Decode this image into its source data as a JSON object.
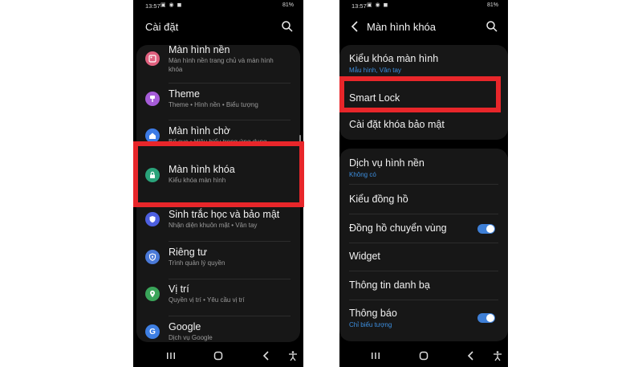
{
  "left": {
    "status": {
      "time": "13:57",
      "battery": "81%"
    },
    "title": "Cài đặt",
    "items": [
      {
        "label": "Màn hình nền",
        "sub": "Màn hình nền trang chủ và màn hình",
        "sub2": "khóa",
        "color": "#e0607e"
      },
      {
        "label": "Theme",
        "sub": "Theme  •  Hình nền  •  Biểu tượng",
        "color": "#a65cd8"
      },
      {
        "label": "Màn hình chờ",
        "sub": "Bố cục  •  Hiệu biểu trong ứng dụng",
        "color": "#3d7be6"
      },
      {
        "label": "Màn hình khóa",
        "sub": "Kiểu khóa màn hình",
        "color": "#2aa37a"
      },
      {
        "label": "Sinh trắc học và bảo mật",
        "sub": "Nhận diện khuôn mặt  •  Vân tay",
        "color": "#4d5fe0"
      },
      {
        "label": "Riêng tư",
        "sub": "Trình quản lý quyền",
        "color": "#4a79d8"
      },
      {
        "label": "Vị trí",
        "sub": "Quyền vị trí  •  Yêu cầu vị trí",
        "color": "#3aa55a"
      },
      {
        "label": "Google",
        "sub": "Dịch vụ Google",
        "color": "#3e7fe3"
      }
    ]
  },
  "right": {
    "status": {
      "time": "13:57",
      "battery": "81%"
    },
    "title": "Màn hình khóa",
    "card1": [
      {
        "label": "Kiểu khóa màn hình",
        "sub": "Mẫu hình, Vân tay"
      },
      {
        "label": "Smart Lock"
      },
      {
        "label": "Cài đặt khóa bảo mật"
      }
    ],
    "card2": [
      {
        "label": "Dịch vụ hình nền",
        "sub": "Không có"
      },
      {
        "label": "Kiểu đồng hồ"
      },
      {
        "label": "Đồng hồ chuyển vùng",
        "toggle": true
      },
      {
        "label": "Widget"
      },
      {
        "label": "Thông tin danh bạ"
      },
      {
        "label": "Thông báo",
        "sub": "Chỉ biểu tượng",
        "toggle": true
      }
    ]
  },
  "colors": {
    "highlight": "#e8262a",
    "accent": "#3e7fd6",
    "subtext_accent": "#3d8fe0"
  }
}
